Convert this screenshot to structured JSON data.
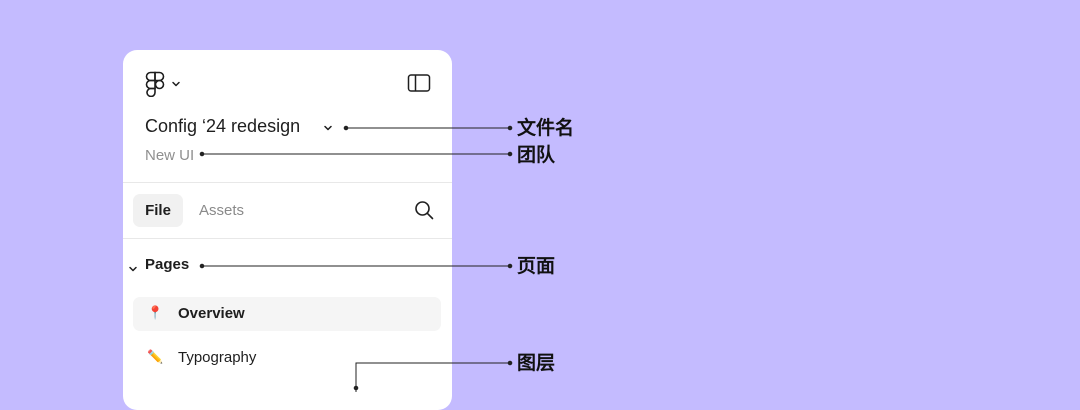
{
  "sidebar": {
    "logo_icon": "figma-logo-icon",
    "logo_menu_icon": "chevron-down-icon",
    "toggle_icon": "sidebar-toggle-icon",
    "file_title": "Config ‘24 redesign",
    "team_name": "New UI",
    "tabs": [
      {
        "label": "File",
        "active": true
      },
      {
        "label": "Assets",
        "active": false
      }
    ],
    "search_icon": "search-icon",
    "pages_heading": "Pages",
    "pages": [
      {
        "emoji": "📍",
        "label": "Overview",
        "active": true
      },
      {
        "emoji": "✏️",
        "label": "Typography",
        "active": false
      }
    ]
  },
  "annotations": {
    "file_name": "文件名",
    "team": "团队",
    "pages": "页面",
    "layers": "图层"
  },
  "colors": {
    "background": "#c4bbff",
    "panel": "#ffffff",
    "text": "#1e1e1e",
    "muted": "#8f8f8f",
    "active_item": "#f5f5f5"
  }
}
